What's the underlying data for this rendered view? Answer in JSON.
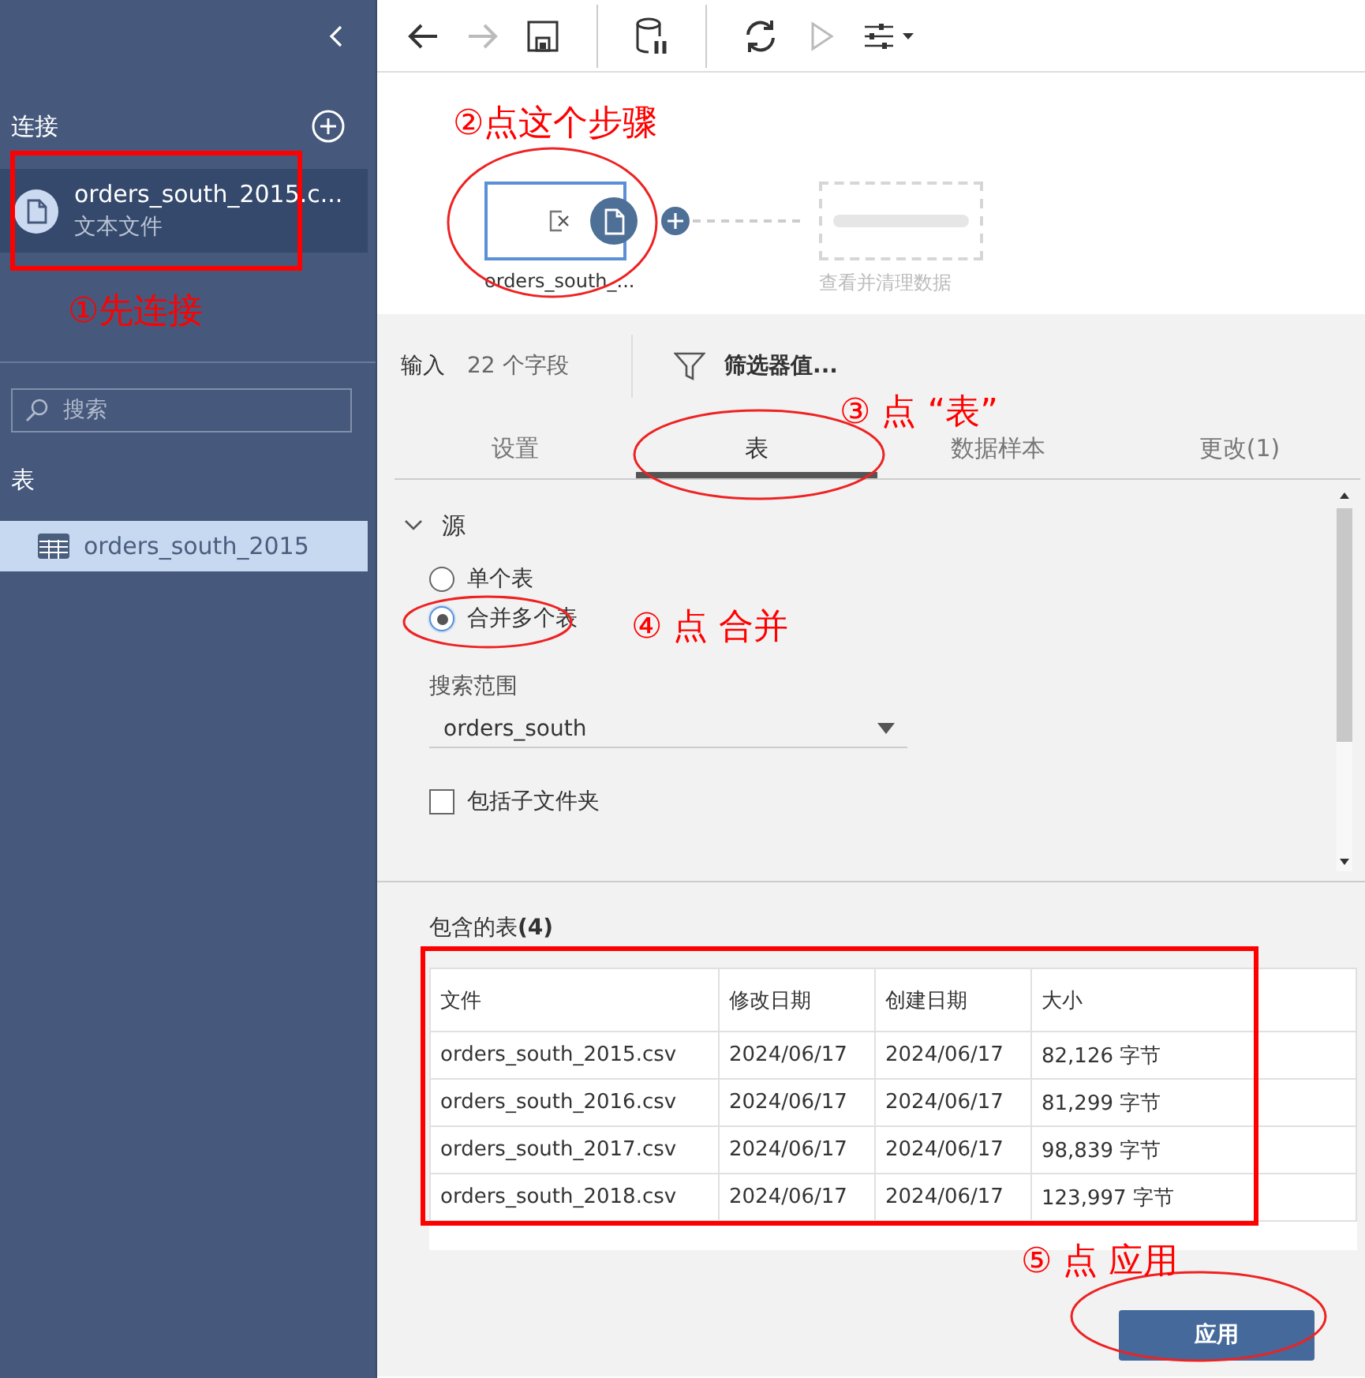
{
  "sidebar": {
    "connections_title": "连接",
    "connections": [
      {
        "name": "orders_south_2015.c...",
        "type": "文本文件",
        "selected": true
      }
    ],
    "search": {
      "placeholder": "搜索"
    },
    "tables_title": "表",
    "tables": [
      {
        "name": "orders_south_2015",
        "selected": true
      }
    ]
  },
  "toolbar": {
    "items": [
      {
        "kind": "back",
        "disabled": false
      },
      {
        "kind": "forward",
        "disabled": true
      },
      {
        "kind": "save",
        "disabled": false
      },
      {
        "kind": "separator"
      },
      {
        "kind": "extract",
        "disabled": false
      },
      {
        "kind": "separator"
      },
      {
        "kind": "refresh",
        "disabled": false
      },
      {
        "kind": "run",
        "disabled": true
      },
      {
        "kind": "options",
        "disabled": false
      }
    ]
  },
  "flow": {
    "steps": [
      {
        "kind": "input",
        "label": "orders_south_...",
        "selected": true
      },
      {
        "kind": "placeholder",
        "label": "查看并清理数据"
      }
    ]
  },
  "panel": {
    "input_label": "输入",
    "field_count": "22 个字段",
    "filter": "筛选器值...",
    "tabs": [
      {
        "label": "设置",
        "selected": false
      },
      {
        "label": "表",
        "selected": true
      },
      {
        "label": "数据样本",
        "selected": false
      },
      {
        "label": "更改(1)",
        "selected": false
      }
    ],
    "source": {
      "title": "源",
      "expanded": true,
      "options": [
        {
          "label": "单个表",
          "selected": false
        },
        {
          "label": "合并多个表",
          "selected": true
        }
      ],
      "search_scope": {
        "label": "搜索范围",
        "value": "orders_south"
      },
      "include_subfolders": {
        "label": "包括子文件夹",
        "checked": false
      }
    },
    "included": {
      "title": "包含的表**(4)**",
      "columns": [
        "文件",
        "修改日期",
        "创建日期",
        "大小"
      ],
      "rows": [
        [
          "orders_south_2015.csv",
          "2024/06/17",
          "2024/06/17",
          "82,126 字节"
        ],
        [
          "orders_south_2016.csv",
          "2024/06/17",
          "2024/06/17",
          "81,299 字节"
        ],
        [
          "orders_south_2017.csv",
          "2024/06/17",
          "2024/06/17",
          "98,839 字节"
        ],
        [
          "orders_south_2018.csv",
          "2024/06/17",
          "2024/06/17",
          "123,997 字节"
        ]
      ]
    },
    "apply_button": "应用"
  },
  "annotations": [
    {
      "kind": "rect"
    },
    {
      "kind": "text",
      "text": "①先连接"
    },
    {
      "kind": "text",
      "text": "②点这个步骤"
    },
    {
      "kind": "ellipse"
    },
    {
      "kind": "text",
      "text": "③ 点 “表”"
    },
    {
      "kind": "ellipse"
    },
    {
      "kind": "ellipse"
    },
    {
      "kind": "text",
      "text": "④ 点 合并"
    },
    {
      "kind": "rect"
    },
    {
      "kind": "text",
      "text": "⑤ 点 应用"
    },
    {
      "kind": "ellipse"
    }
  ]
}
